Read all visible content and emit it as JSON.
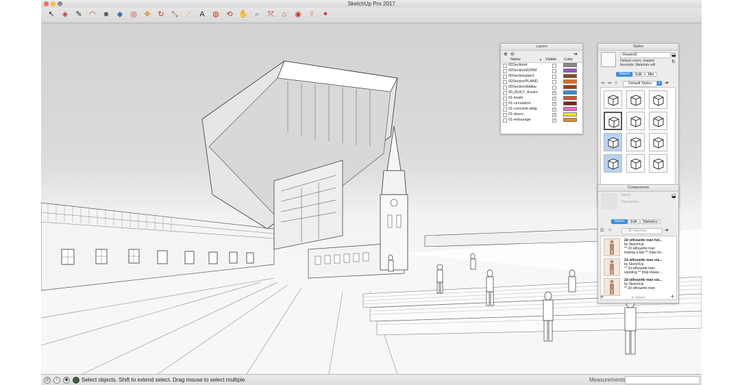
{
  "window": {
    "title": "SketchUp Pro 2017",
    "traffic_light_colors": [
      "#fc605c",
      "#fdbc40",
      "#8a8a8a"
    ]
  },
  "toolbar": {
    "tools": [
      {
        "name": "select-tool-icon",
        "glyph": "↖"
      },
      {
        "name": "eraser-tool-icon",
        "glyph": "◈"
      },
      {
        "name": "pencil-tool-icon",
        "glyph": "✎"
      },
      {
        "name": "arc-tool-icon",
        "glyph": "◠"
      },
      {
        "name": "shape-tool-icon",
        "glyph": "■"
      },
      {
        "name": "push-pull-tool-icon",
        "glyph": "◆"
      },
      {
        "name": "offset-tool-icon",
        "glyph": "◎"
      },
      {
        "name": "move-tool-icon",
        "glyph": "✥"
      },
      {
        "name": "rotate-tool-icon",
        "glyph": "↻"
      },
      {
        "name": "scale-tool-icon",
        "glyph": "⤡"
      },
      {
        "name": "tape-measure-icon",
        "glyph": "⟋"
      },
      {
        "name": "text-tool-icon",
        "glyph": "A"
      },
      {
        "name": "paint-bucket-icon",
        "glyph": "◍"
      },
      {
        "name": "orbit-tool-icon",
        "glyph": "⟲"
      },
      {
        "name": "pan-tool-icon",
        "glyph": "✋"
      },
      {
        "name": "zoom-tool-icon",
        "glyph": "⌕"
      },
      {
        "name": "zoom-extents-icon",
        "glyph": "⤧"
      },
      {
        "name": "warehouse-icon",
        "glyph": "⌂"
      },
      {
        "name": "extension-warehouse-icon",
        "glyph": "◉"
      },
      {
        "name": "share-model-icon",
        "glyph": "⇪"
      },
      {
        "name": "layout-icon",
        "glyph": "✦"
      }
    ],
    "accent_colors": {
      "red": "#c8361b",
      "orange": "#e8891f",
      "blue": "#3d6fb0"
    }
  },
  "layers": {
    "title": "Layers",
    "headers": {
      "name": "Name",
      "sort": "▲",
      "visible": "Visible",
      "color": "Color"
    },
    "rows": [
      {
        "name": "00Section4",
        "visible": false,
        "color": "#8a8a8a"
      },
      {
        "name": "00SectionDORM",
        "visible": false,
        "color": "#9b4fd1"
      },
      {
        "name": "00Sectionplan1",
        "visible": false,
        "color": "#8a4a1c"
      },
      {
        "name": "00SectionPLAND",
        "visible": false,
        "color": "#e86a17"
      },
      {
        "name": "00SectionWalkw:",
        "visible": false,
        "color": "#a33a14"
      },
      {
        "name": "00_BUILT_Enviro",
        "visible": true,
        "color": "#2f8fd8"
      },
      {
        "name": "01-boats",
        "visible": true,
        "color": "#d8532b"
      },
      {
        "name": "01-circulation",
        "visible": true,
        "color": "#7a2b10"
      },
      {
        "name": "01-concrete-bldg",
        "visible": true,
        "color": "#f06ac8"
      },
      {
        "name": "01-doors",
        "visible": true,
        "color": "#f5ec21"
      },
      {
        "name": "01-entourage",
        "visible": true,
        "color": "#e8891f"
      }
    ]
  },
  "styles": {
    "title": "Styles",
    "current_name": "Shaded2",
    "description": "Default colors, shaded facestyle. Materials will",
    "tabs": [
      "Select",
      "Edit",
      "Mix"
    ],
    "collection": "Default Styles"
  },
  "components": {
    "title": "Components",
    "name_placeholder": "Name",
    "description_placeholder": "Description",
    "tabs": [
      "Select",
      "Edit",
      "Statistics"
    ],
    "search_placeholder": "3D Warehou",
    "items": [
      {
        "line1": "2d silhouette man hol...",
        "line2": "by SketchUp",
        "line3": "** 2d silhouette man",
        "line4": "holding a bell ** (http://w..."
      },
      {
        "line1": "2d silhouette man sta...",
        "line2": "by SketchUp",
        "line3": "** 2d silhouette man",
        "line4": "standing ** (http://www...."
      },
      {
        "line1": "2d silhouette man sta...",
        "line2": "by SketchUp",
        "line3": "** 2d silhouette man",
        "line4": ""
      }
    ],
    "footer": "In Model"
  },
  "statusbar": {
    "message": "Select objects. Shift to extend select. Drag mouse to select multiple.",
    "measurements_label": "Measurements",
    "measurements_value": ""
  }
}
